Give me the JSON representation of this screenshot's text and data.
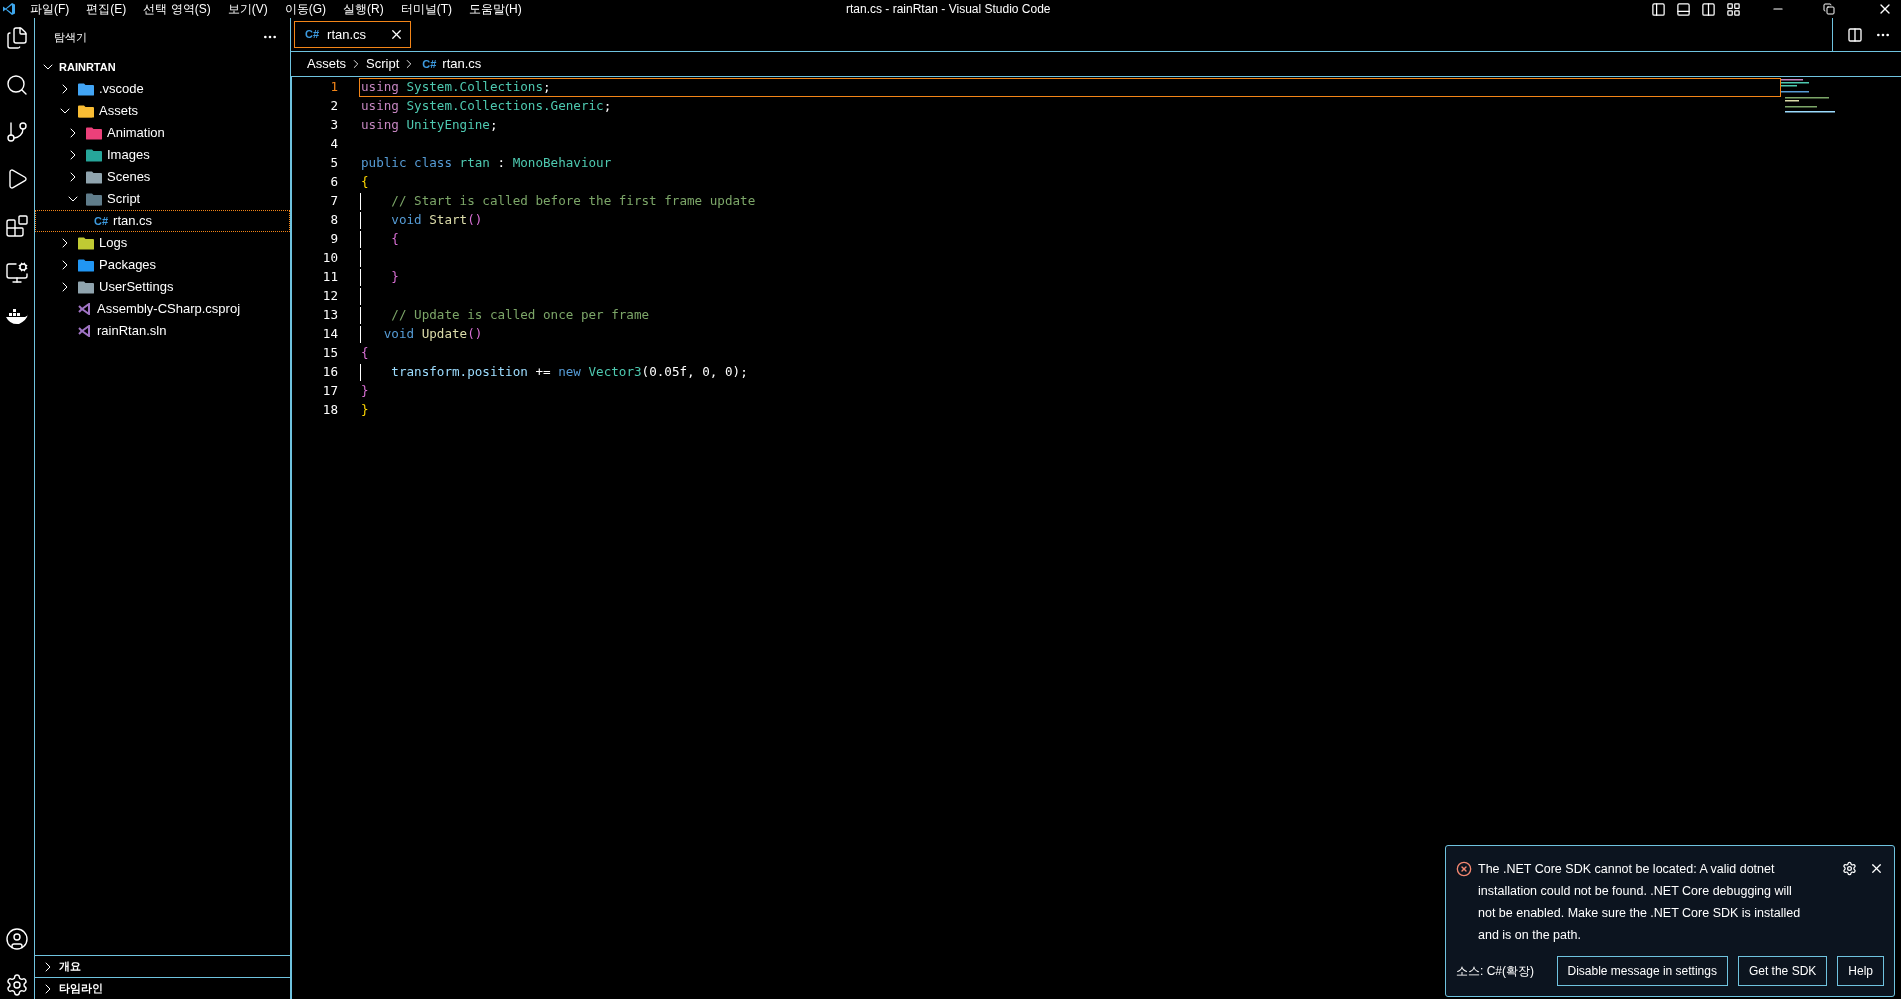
{
  "title_bar": {
    "menu": [
      "파일(F)",
      "편집(E)",
      "선택 영역(S)",
      "보기(V)",
      "이동(G)",
      "실행(R)",
      "터미널(T)",
      "도움말(H)"
    ],
    "title": "rtan.cs - rainRtan - Visual Studio Code"
  },
  "sidebar": {
    "title": "탐색기",
    "root": {
      "label": "RAINRTAN",
      "expanded": true
    },
    "tree": [
      {
        "label": ".vscode",
        "kind": "folder",
        "color": "#42a5f5",
        "expanded": false,
        "selected": false
      },
      {
        "label": "Assets",
        "kind": "folder",
        "color": "#f9bd34",
        "expanded": true,
        "selected": false,
        "children": [
          {
            "label": "Animation",
            "kind": "folder",
            "color": "#ec407a",
            "expanded": false,
            "selected": false
          },
          {
            "label": "Images",
            "kind": "folder",
            "color": "#26a69a",
            "expanded": false,
            "selected": false
          },
          {
            "label": "Scenes",
            "kind": "folder",
            "color": "#90a4ae",
            "expanded": false,
            "selected": false
          },
          {
            "label": "Script",
            "kind": "folder",
            "color": "#607d8b",
            "expanded": true,
            "selected": false,
            "children": [
              {
                "label": "rtan.cs",
                "kind": "csharp",
                "icon_text": "C#",
                "selected": true
              }
            ]
          }
        ]
      },
      {
        "label": "Logs",
        "kind": "folder",
        "color": "#c0ca33",
        "expanded": false,
        "selected": false
      },
      {
        "label": "Packages",
        "kind": "folder",
        "color": "#2196f3",
        "expanded": false,
        "selected": false
      },
      {
        "label": "UserSettings",
        "kind": "folder",
        "color": "#90a4ae",
        "expanded": false,
        "selected": false
      },
      {
        "label": "Assembly-CSharp.csproj",
        "kind": "vs",
        "color": "#a074c4",
        "selected": false
      },
      {
        "label": "rainRtan.sln",
        "kind": "vs",
        "color": "#a074c4",
        "selected": false
      }
    ],
    "sections": [
      {
        "label": "개요",
        "expanded": false
      },
      {
        "label": "타임라인",
        "expanded": false
      }
    ]
  },
  "editor": {
    "tabs": [
      {
        "label": "rtan.cs",
        "icon_text": "C#",
        "selected": true
      }
    ],
    "breadcrumb": [
      {
        "label": "Assets"
      },
      {
        "label": "Script"
      },
      {
        "label": "rtan.cs",
        "icon_text": "C#"
      }
    ],
    "lines": [
      {
        "number": "1",
        "current": true,
        "guide": false,
        "tokens": [
          {
            "t": "using",
            "kind": "keyword"
          },
          {
            "t": " System.Collections",
            "kind": "type"
          },
          {
            "t": ";",
            "kind": "plain"
          }
        ]
      },
      {
        "number": "2",
        "current": false,
        "guide": false,
        "tokens": [
          {
            "t": "using",
            "kind": "keyword"
          },
          {
            "t": " System.Collections.Generic",
            "kind": "type"
          },
          {
            "t": ";",
            "kind": "plain"
          }
        ]
      },
      {
        "number": "3",
        "current": false,
        "guide": false,
        "tokens": [
          {
            "t": "using",
            "kind": "keyword"
          },
          {
            "t": " UnityEngine",
            "kind": "type"
          },
          {
            "t": ";",
            "kind": "plain"
          }
        ]
      },
      {
        "number": "4",
        "current": false,
        "guide": false
      },
      {
        "number": "5",
        "current": false,
        "guide": false,
        "tokens": [
          {
            "t": "public class",
            "kind": "storage"
          },
          {
            "t": " rtan",
            "kind": "type"
          },
          {
            "t": " :",
            "kind": "plain"
          },
          {
            "t": " MonoBehaviour",
            "kind": "type"
          }
        ]
      },
      {
        "number": "6",
        "current": false,
        "guide": false,
        "tokens": [
          {
            "t": "{",
            "kind": "bracket1"
          }
        ]
      },
      {
        "number": "7",
        "current": false,
        "guide": true,
        "tokens": [
          {
            "t": "    // Start is called before the first frame update",
            "kind": "comment"
          }
        ]
      },
      {
        "number": "8",
        "current": false,
        "guide": true,
        "tokens": [
          {
            "t": "    void",
            "kind": "storage"
          },
          {
            "t": " Start",
            "kind": "function"
          },
          {
            "t": "()",
            "kind": "bracket2"
          }
        ]
      },
      {
        "number": "9",
        "current": false,
        "guide": true,
        "tokens": [
          {
            "t": "    {",
            "kind": "bracket2"
          }
        ]
      },
      {
        "number": "10",
        "current": false,
        "guide": true
      },
      {
        "number": "11",
        "current": false,
        "guide": true,
        "tokens": [
          {
            "t": "    }",
            "kind": "bracket2"
          }
        ]
      },
      {
        "number": "12",
        "current": false,
        "guide": true
      },
      {
        "number": "13",
        "current": false,
        "guide": true,
        "tokens": [
          {
            "t": "    // Update is called once per frame",
            "kind": "comment"
          }
        ]
      },
      {
        "number": "14",
        "current": false,
        "guide": true,
        "tokens": [
          {
            "t": "   void",
            "kind": "storage"
          },
          {
            "t": " Update",
            "kind": "function"
          },
          {
            "t": "()",
            "kind": "bracket2"
          }
        ]
      },
      {
        "number": "15",
        "current": false,
        "guide": false,
        "tokens": [
          {
            "t": "{",
            "kind": "bracket2"
          }
        ]
      },
      {
        "number": "16",
        "current": false,
        "guide": true,
        "tokens": [
          {
            "t": "    transform.position",
            "kind": "variable"
          },
          {
            "t": " +=",
            "kind": "plain"
          },
          {
            "t": " new",
            "kind": "storage"
          },
          {
            "t": " Vector3",
            "kind": "type"
          },
          {
            "t": "(0.05f, 0, 0);",
            "kind": "plain"
          }
        ]
      },
      {
        "number": "17",
        "current": false,
        "guide": false,
        "tokens": [
          {
            "t": "}",
            "kind": "bracket2"
          }
        ]
      },
      {
        "number": "18",
        "current": false,
        "guide": false,
        "tokens": [
          {
            "t": "}",
            "kind": "bracket1"
          }
        ]
      }
    ]
  },
  "notification": {
    "message": "The .NET Core SDK cannot be located: A valid dotnet installation could not be found. .NET Core debugging will not be enabled. Make sure the .NET Core SDK is installed and is on the path.",
    "source": "소스: C#(확장)",
    "buttons": [
      "Disable message in settings",
      "Get the SDK",
      "Help"
    ]
  }
}
